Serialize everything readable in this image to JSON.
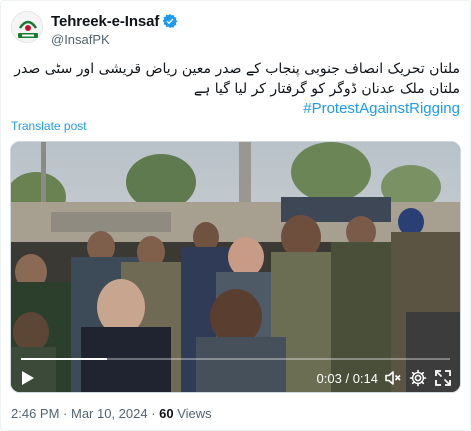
{
  "account": {
    "display_name": "Tehreek-e-Insaf",
    "handle": "@InsafPK",
    "avatar_icon": "pti-logo-icon",
    "verified_icon": "verified-badge-icon",
    "verified_color": "#1d9bf0"
  },
  "tweet": {
    "line1": "ملتان تحریک انصاف جنوبی پنجاب کے صدر معین ریاض قریشی اور سٹی صدر",
    "line2": "ملتان ملک عدنان ڈوگر کو گرفتار کر لیا گیا ہے",
    "hashtag": "#ProtestAgainstRigging",
    "translate_label": "Translate post",
    "link_color": "#1d9bf0"
  },
  "video": {
    "current_time": "0:03",
    "separator": " / ",
    "duration": "0:14",
    "progress": 0.2,
    "play_icon": "play-icon",
    "mute_icon": "mute-icon",
    "settings_icon": "gear-icon",
    "fullscreen_icon": "fullscreen-icon"
  },
  "meta": {
    "time": "2:46 PM",
    "dot": " · ",
    "date": "Mar 10, 2024",
    "views_count": "60",
    "views_label": " Views"
  }
}
